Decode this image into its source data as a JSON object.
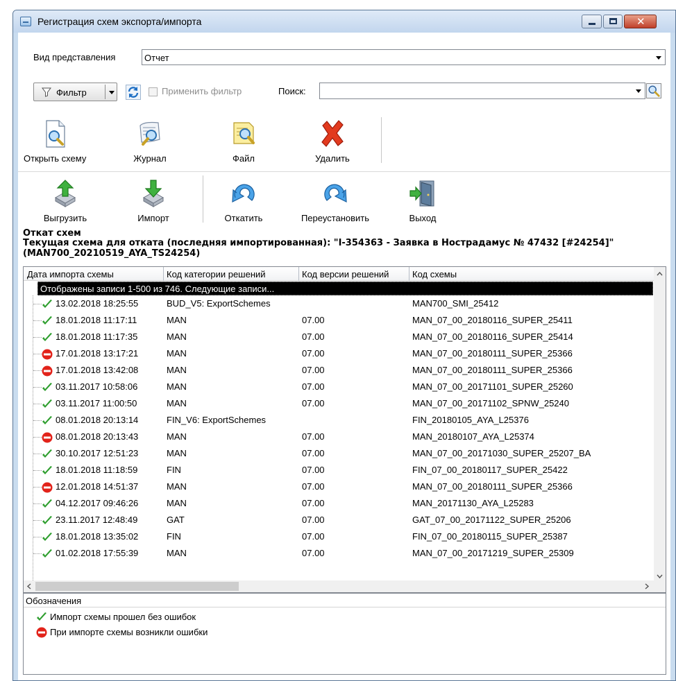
{
  "window": {
    "title": "Регистрация схем экспорта/импорта"
  },
  "view": {
    "label": "Вид представления",
    "value": "Отчет"
  },
  "filter": {
    "button_label": "Фильтр",
    "apply_label": "Применить фильтр",
    "search_label": "Поиск:",
    "search_value": ""
  },
  "toolbar1": {
    "open_scheme": "Открыть схему",
    "journal": "Журнал",
    "file": "Файл",
    "delete": "Удалить"
  },
  "toolbar2": {
    "export": "Выгрузить",
    "import": "Импорт",
    "rollback": "Откатить",
    "reinstall": "Переустановить",
    "exit": "Выход"
  },
  "rollback": {
    "title": "Откат схем",
    "current": "Текущая схема для отката (последняя импортированная): \"I-354363 - Заявка в Нострадамус № 47432 [#24254]\"(MAN700_20210519_AYA_TS24254)"
  },
  "grid": {
    "columns": [
      "Дата импорта схемы",
      "Код категории решений",
      "Код версии решений",
      "Код схемы"
    ],
    "banner": "Отображены записи 1-500 из 746. Следующие записи...",
    "rows": [
      {
        "status": "ok",
        "date": "13.02.2018 18:25:55",
        "category": "BUD_V5: ExportSchemes",
        "version": "",
        "scheme": "MAN700_SMI_25412"
      },
      {
        "status": "ok",
        "date": "18.01.2018 11:17:11",
        "category": "MAN",
        "version": "07.00",
        "scheme": "MAN_07_00_20180116_SUPER_25411"
      },
      {
        "status": "ok",
        "date": "18.01.2018 11:17:35",
        "category": "MAN",
        "version": "07.00",
        "scheme": "MAN_07_00_20180116_SUPER_25414"
      },
      {
        "status": "error",
        "date": "17.01.2018 13:17:21",
        "category": "MAN",
        "version": "07.00",
        "scheme": "MAN_07_00_20180111_SUPER_25366"
      },
      {
        "status": "error",
        "date": "17.01.2018 13:42:08",
        "category": "MAN",
        "version": "07.00",
        "scheme": "MAN_07_00_20180111_SUPER_25366"
      },
      {
        "status": "ok",
        "date": "03.11.2017 10:58:06",
        "category": "MAN",
        "version": "07.00",
        "scheme": "MAN_07_00_20171101_SUPER_25260"
      },
      {
        "status": "ok",
        "date": "03.11.2017 11:00:50",
        "category": "MAN",
        "version": "07.00",
        "scheme": "MAN_07_00_20171102_SPNW_25240"
      },
      {
        "status": "ok",
        "date": "08.01.2018 20:13:14",
        "category": "FIN_V6: ExportSchemes",
        "version": "",
        "scheme": "FIN_20180105_AYA_L25376"
      },
      {
        "status": "error",
        "date": "08.01.2018 20:13:43",
        "category": "MAN",
        "version": "07.00",
        "scheme": "MAN_20180107_AYA_L25374"
      },
      {
        "status": "ok",
        "date": "30.10.2017 12:51:23",
        "category": "MAN",
        "version": "07.00",
        "scheme": "MAN_07_00_20171030_SUPER_25207_BA"
      },
      {
        "status": "ok",
        "date": "18.01.2018 11:18:59",
        "category": "FIN",
        "version": "07.00",
        "scheme": "FIN_07_00_20180117_SUPER_25422"
      },
      {
        "status": "error",
        "date": "12.01.2018 14:51:37",
        "category": "MAN",
        "version": "07.00",
        "scheme": "MAN_07_00_20180111_SUPER_25366"
      },
      {
        "status": "ok",
        "date": "04.12.2017 09:46:26",
        "category": "MAN",
        "version": "07.00",
        "scheme": "MAN_20171130_AYA_L25283"
      },
      {
        "status": "ok",
        "date": "23.11.2017 12:48:49",
        "category": "GAT",
        "version": "07.00",
        "scheme": "GAT_07_00_20171122_SUPER_25206"
      },
      {
        "status": "ok",
        "date": "18.01.2018 13:35:02",
        "category": "FIN",
        "version": "07.00",
        "scheme": "FIN_07_00_20180115_SUPER_25387"
      },
      {
        "status": "ok",
        "date": "01.02.2018 17:55:39",
        "category": "MAN",
        "version": "07.00",
        "scheme": "MAN_07_00_20171219_SUPER_25309"
      }
    ]
  },
  "legend": {
    "title": "Обозначения",
    "ok": "Импорт схемы прошел без ошибок",
    "error": "При импорте схемы возникли ошибки"
  },
  "colors": {
    "ok": "#2e9e2e",
    "error": "#e2231a",
    "accent": "#1e6fc4"
  },
  "icons": {
    "ok": "checkmark-icon",
    "error": "no-entry-icon",
    "refresh": "refresh-icon",
    "filter": "funnel-icon",
    "search": "magnifier-icon"
  }
}
